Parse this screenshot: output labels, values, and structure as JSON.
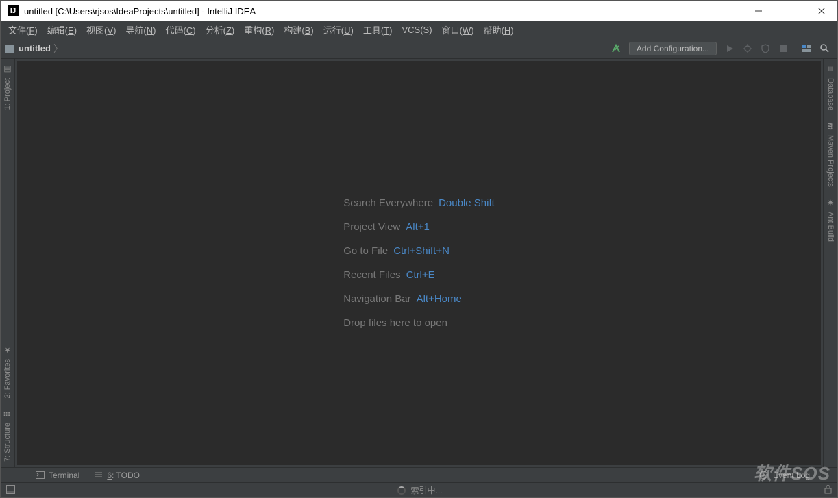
{
  "titlebar": {
    "title": "untitled [C:\\Users\\rjsos\\IdeaProjects\\untitled] - IntelliJ IDEA",
    "app_icon_text": "IJ"
  },
  "menu": {
    "file": {
      "label": "文件",
      "key": "F"
    },
    "edit": {
      "label": "编辑",
      "key": "E"
    },
    "view": {
      "label": "视图",
      "key": "V"
    },
    "nav": {
      "label": "导航",
      "key": "N"
    },
    "code": {
      "label": "代码",
      "key": "C"
    },
    "analyze": {
      "label": "分析",
      "key": "Z"
    },
    "refactor": {
      "label": "重构",
      "key": "R"
    },
    "build": {
      "label": "构建",
      "key": "B"
    },
    "run": {
      "label": "运行",
      "key": "U"
    },
    "tools": {
      "label": "工具",
      "key": "T"
    },
    "vcs": {
      "label": "VCS",
      "key": "S"
    },
    "window": {
      "label": "窗口",
      "key": "W"
    },
    "help": {
      "label": "帮助",
      "key": "H"
    }
  },
  "navbar": {
    "crumb": "untitled",
    "add_configuration": "Add Configuration..."
  },
  "left_tools": {
    "project": "1: Project",
    "favorites": "2: Favorites",
    "structure": "7: Structure"
  },
  "right_tools": {
    "database": "Database",
    "maven": "Maven Projects",
    "ant": "Ant Build"
  },
  "hints": [
    {
      "label": "Search Everywhere",
      "shortcut": "Double Shift"
    },
    {
      "label": "Project View",
      "shortcut": "Alt+1"
    },
    {
      "label": "Go to File",
      "shortcut": "Ctrl+Shift+N"
    },
    {
      "label": "Recent Files",
      "shortcut": "Ctrl+E"
    },
    {
      "label": "Navigation Bar",
      "shortcut": "Alt+Home"
    },
    {
      "label": "Drop files here to open",
      "shortcut": ""
    }
  ],
  "bottom": {
    "terminal": "Terminal",
    "todo_underline": "6",
    "todo_rest": ": TODO",
    "event_log": "Event Log"
  },
  "status": {
    "indexing": "索引中..."
  },
  "watermark": "软件SOS"
}
